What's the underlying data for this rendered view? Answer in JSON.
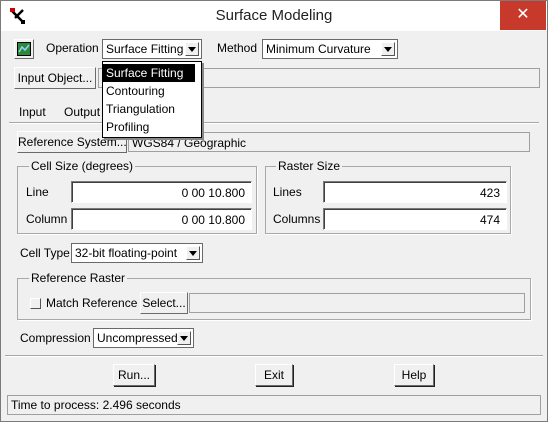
{
  "window": {
    "title": "Surface Modeling"
  },
  "toolbar": {
    "operation_label": "Operation",
    "operation_value": "Surface Fitting",
    "method_label": "Method",
    "method_value": "Minimum Curvature"
  },
  "operation_menu": {
    "items": [
      "Surface Fitting",
      "Contouring",
      "Triangulation",
      "Profiling"
    ],
    "selected_index": 0
  },
  "input_object": {
    "button_label": "Input Object..."
  },
  "tabs": {
    "input": "Input",
    "output": "Output"
  },
  "reference_system": {
    "button_label": "Reference System...",
    "value": "WGS84 / Geographic"
  },
  "cell_size": {
    "title": "Cell Size (degrees)",
    "line_label": "Line",
    "line_value": "0 00 10.800",
    "column_label": "Column",
    "column_value": "0 00 10.800"
  },
  "raster_size": {
    "title": "Raster Size",
    "lines_label": "Lines",
    "lines_value": "423",
    "columns_label": "Columns",
    "columns_value": "474"
  },
  "cell_type": {
    "label": "Cell Type",
    "value": "32-bit floating-point"
  },
  "reference_raster": {
    "title": "Reference Raster",
    "match_label": "Match Reference",
    "match_checked": false,
    "select_label": "Select..."
  },
  "compression": {
    "label": "Compression",
    "value": "Uncompressed"
  },
  "buttons": {
    "run": "Run...",
    "exit": "Exit",
    "help": "Help"
  },
  "status": {
    "text": "Time to process: 2.496 seconds"
  },
  "icons": {
    "app": "tools-icon",
    "close": "close-icon",
    "tool": "surface-tool-icon"
  },
  "colors": {
    "close_button": "#c7392b",
    "selection": "#000000"
  }
}
